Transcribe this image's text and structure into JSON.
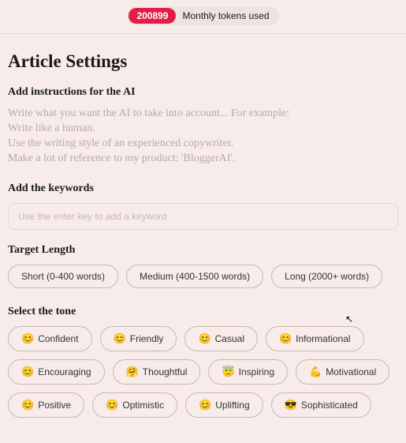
{
  "top": {
    "token_count": "200899",
    "token_label": "Monthly tokens used"
  },
  "title": "Article Settings",
  "instructions": {
    "heading": "Add instructions for the AI",
    "lines": [
      "Write what you want the AI to take into account... For example:",
      "Write like a human.",
      "Use the writing style of an experienced copywriter.",
      "Make a lot of reference to my product: 'BloggerAI'."
    ]
  },
  "keywords": {
    "heading": "Add the keywords",
    "placeholder": "Use the enter key to add a keyword"
  },
  "length": {
    "heading": "Target Length",
    "options": [
      "Short (0-400 words)",
      "Medium (400-1500 words)",
      "Long (2000+ words)"
    ]
  },
  "tone": {
    "heading": "Select the tone",
    "options": [
      {
        "emoji": "😊",
        "label": "Confident"
      },
      {
        "emoji": "😊",
        "label": "Friendly"
      },
      {
        "emoji": "😊",
        "label": "Casual"
      },
      {
        "emoji": "😊",
        "label": "Informational"
      },
      {
        "emoji": "😊",
        "label": "Encouraging"
      },
      {
        "emoji": "🤗",
        "label": "Thoughtful"
      },
      {
        "emoji": "😇",
        "label": "Inspiring"
      },
      {
        "emoji": "💪",
        "label": "Motivational"
      },
      {
        "emoji": "😊",
        "label": "Positive"
      },
      {
        "emoji": "😊",
        "label": "Optimistic"
      },
      {
        "emoji": "😊",
        "label": "Uplifting"
      },
      {
        "emoji": "😎",
        "label": "Sophisticated"
      }
    ]
  }
}
